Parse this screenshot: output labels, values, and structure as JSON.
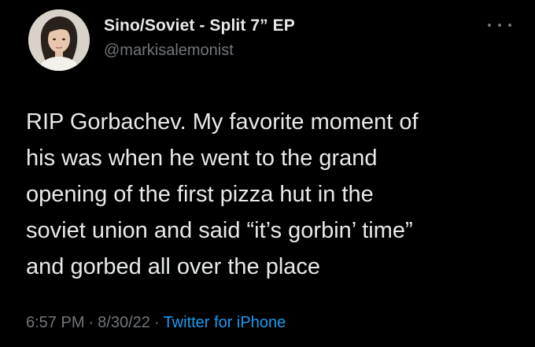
{
  "tweet": {
    "author": {
      "display_name": "Sino/Soviet - Split 7” EP",
      "handle": "@markisalemonist",
      "avatar": "profile-photo"
    },
    "more_icon": "ellipsis-icon",
    "text": "RIP Gorbachev. My favorite moment of\nhis was when he went to the grand\nopening of the first pizza hut in the\nsoviet union and said “it’s gorbin’ time”\nand gorbed all over the place",
    "time": "6:57 PM",
    "separator": "·",
    "date": "8/30/22",
    "client": "Twitter for iPhone"
  },
  "colors": {
    "background": "#000000",
    "primary_text": "#e7e9ea",
    "secondary_text": "#71767b",
    "link": "#1d9bf0"
  }
}
